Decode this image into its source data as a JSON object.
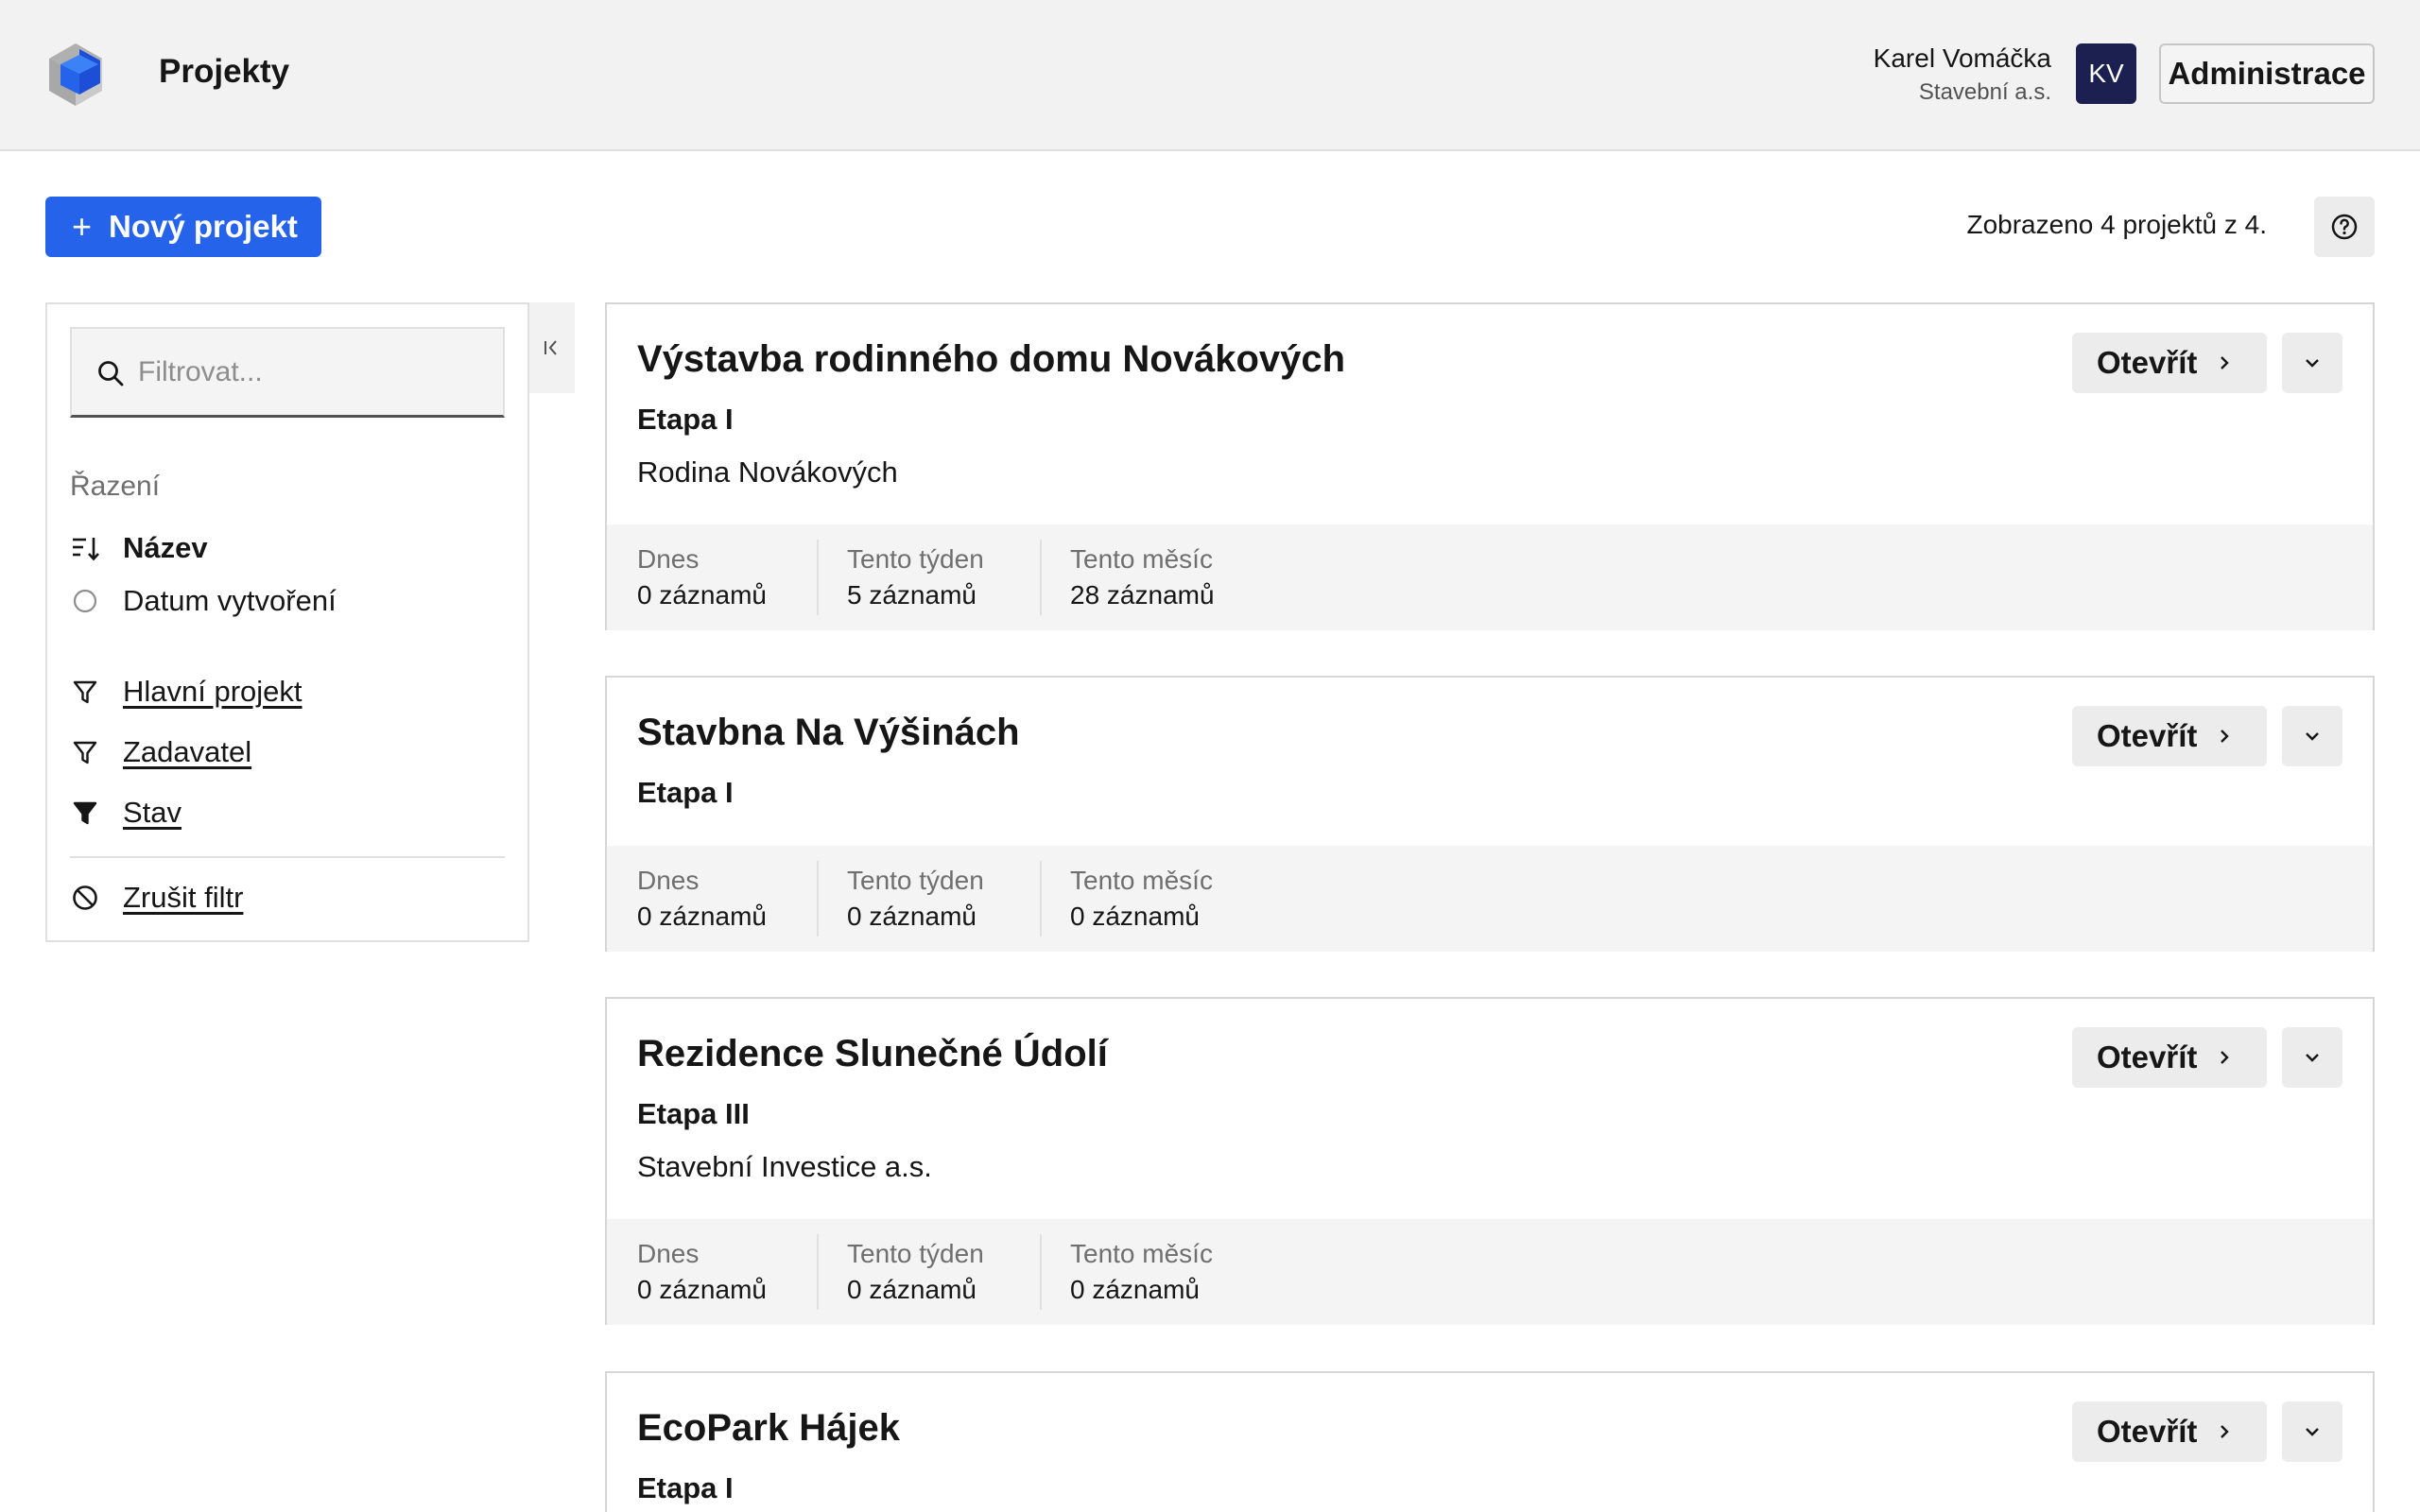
{
  "header": {
    "app_title": "Projekty",
    "user_name": "Karel Vomáčka",
    "user_company": "Stavební a.s.",
    "avatar_initials": "KV",
    "admin_label": "Administrace"
  },
  "toolbar": {
    "new_project_label": "Nový projekt",
    "count_text": "Zobrazeno 4 projektů z 4.",
    "help_icon": "help-circle-icon"
  },
  "sidebar": {
    "search_placeholder": "Filtrovat...",
    "sort_heading": "Řazení",
    "sort_options": [
      {
        "label": "Název",
        "selected": true
      },
      {
        "label": "Datum vytvoření",
        "selected": false
      }
    ],
    "filters": [
      {
        "label": "Hlavní projekt",
        "active": false
      },
      {
        "label": "Zadavatel",
        "active": false
      },
      {
        "label": "Stav",
        "active": true
      }
    ],
    "clear_filter_label": "Zrušit filtr"
  },
  "stat_labels": {
    "today": "Dnes",
    "week": "Tento týden",
    "month": "Tento měsíc"
  },
  "card_actions": {
    "open_label": "Otevřít"
  },
  "projects": [
    {
      "title": "Výstavba rodinného domu Novákových",
      "stage": "Etapa I",
      "client": "Rodina Novákových",
      "today": "0 záznamů",
      "week": "5 záznamů",
      "month": "28 záznamů"
    },
    {
      "title": "Stavbna Na Výšinách",
      "stage": "Etapa I",
      "client": "",
      "today": "0 záznamů",
      "week": "0 záznamů",
      "month": "0 záznamů"
    },
    {
      "title": "Rezidence Slunečné Údolí",
      "stage": "Etapa III",
      "client": "Stavební Investice a.s.",
      "today": "0 záznamů",
      "week": "0 záznamů",
      "month": "0 záznamů"
    },
    {
      "title": "EcoPark Hájek",
      "stage": "Etapa I"
    }
  ],
  "colors": {
    "primary": "#2563eb",
    "avatar_bg": "#1c2050",
    "header_bg": "#f2f2f2"
  }
}
